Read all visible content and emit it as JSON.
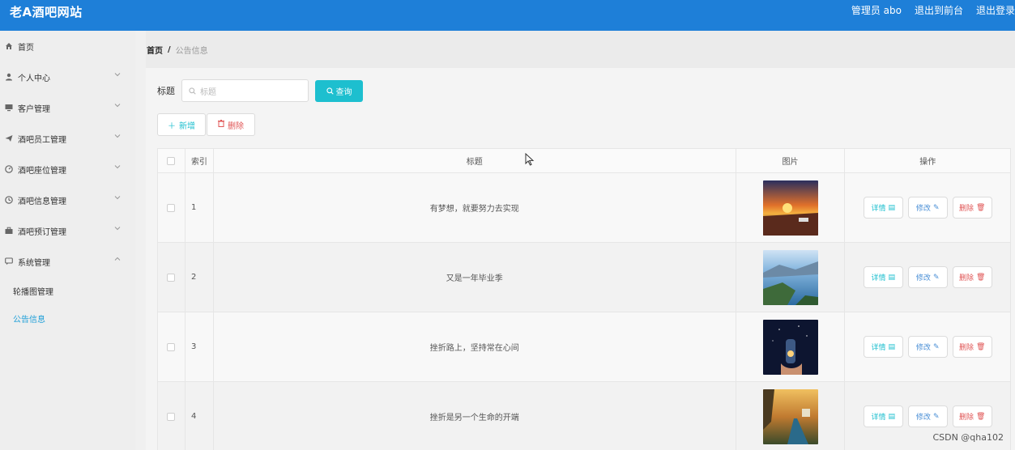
{
  "header": {
    "site_title": "老A酒吧网站",
    "admin_label": "管理员 abo",
    "to_frontend": "退出到前台",
    "logout": "退出登录"
  },
  "sidebar": {
    "items": [
      {
        "label": "首页",
        "icon": "home-icon"
      },
      {
        "label": "个人中心",
        "icon": "user-icon"
      },
      {
        "label": "客户管理",
        "icon": "monitor-icon"
      },
      {
        "label": "酒吧员工管理",
        "icon": "send-icon"
      },
      {
        "label": "酒吧座位管理",
        "icon": "gauge-icon"
      },
      {
        "label": "酒吧信息管理",
        "icon": "clock-icon"
      },
      {
        "label": "酒吧预订管理",
        "icon": "briefcase-icon"
      },
      {
        "label": "系统管理",
        "icon": "chat-icon"
      }
    ],
    "subitems": [
      {
        "label": "轮播图管理"
      },
      {
        "label": "公告信息"
      }
    ]
  },
  "breadcrumb": {
    "home": "首页",
    "separator": "/",
    "current": "公告信息"
  },
  "search": {
    "label": "标题",
    "placeholder": "标题",
    "button": "查询"
  },
  "actions": {
    "add": "新增",
    "delete": "删除"
  },
  "table": {
    "headers": {
      "index": "索引",
      "title": "标题",
      "image": "图片",
      "operation": "操作"
    },
    "rows": [
      {
        "index": "1",
        "title": "有梦想，就要努力去实现"
      },
      {
        "index": "2",
        "title": "又是一年毕业季"
      },
      {
        "index": "3",
        "title": "挫折路上，坚持常在心间"
      },
      {
        "index": "4",
        "title": "挫折是另一个生命的开端"
      }
    ],
    "op_labels": {
      "detail": "详情",
      "edit": "修改",
      "remove": "删除"
    }
  },
  "watermark": "CSDN @qha102",
  "colors": {
    "header_bg": "#1e7fd8",
    "primary": "#1dbfcf",
    "danger": "#e05555"
  }
}
